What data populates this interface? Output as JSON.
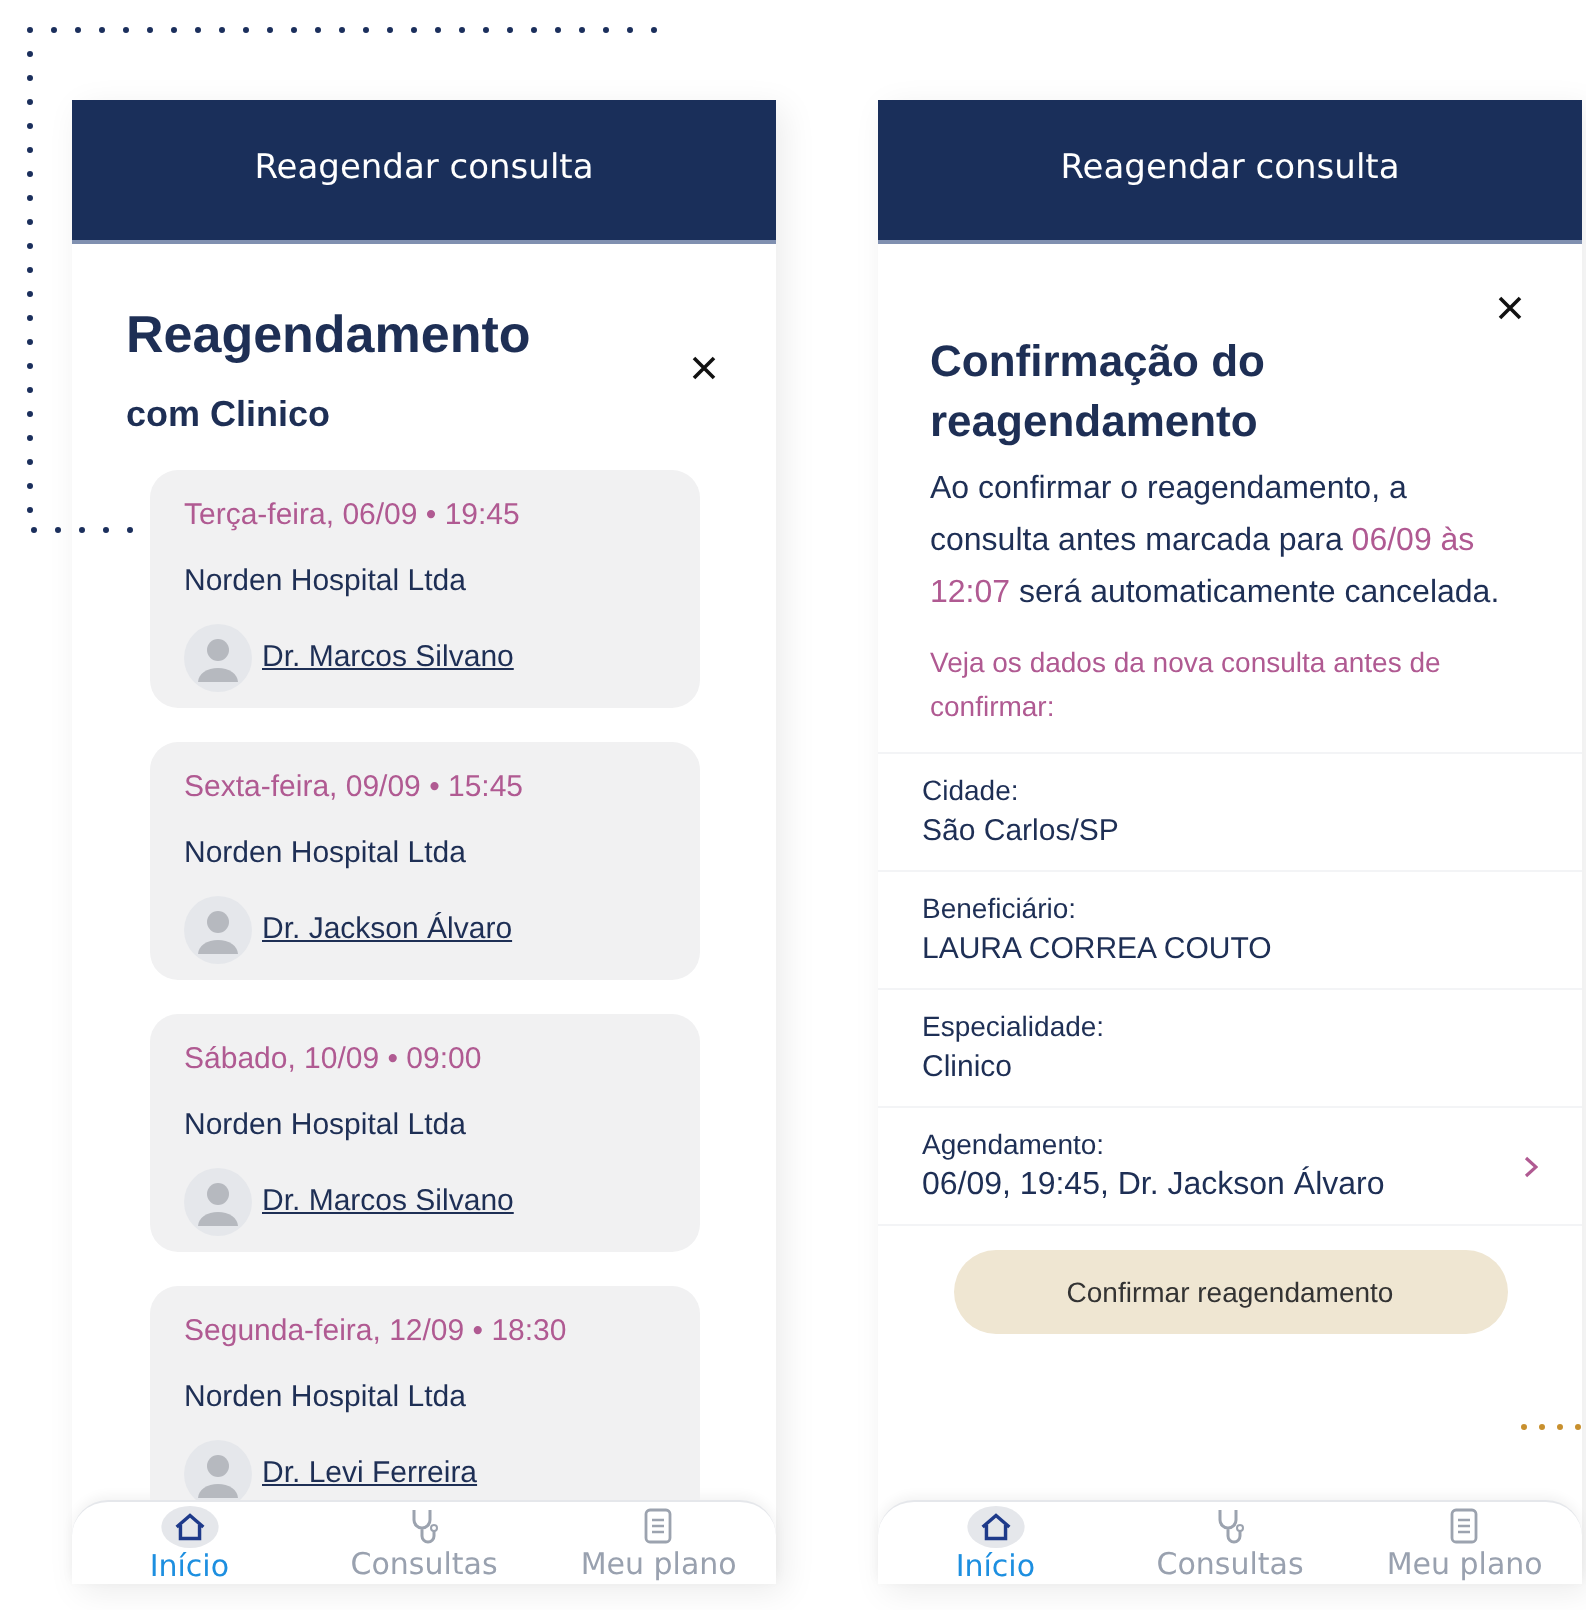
{
  "left_screen": {
    "header": "Reagendar consulta",
    "title": "Reagendamento",
    "subtitle": "com Clinico",
    "slots": [
      {
        "when": "Terça-feira, 06/09 • 19:45",
        "place": "Norden Hospital Ltda",
        "doctor": "Dr. Marcos Silvano"
      },
      {
        "when": "Sexta-feira, 09/09 • 15:45",
        "place": "Norden Hospital Ltda",
        "doctor": "Dr. Jackson Álvaro"
      },
      {
        "when": "Sábado, 10/09 • 09:00",
        "place": "Norden Hospital Ltda",
        "doctor": "Dr. Marcos Silvano"
      },
      {
        "when": "Segunda-feira, 12/09 • 18:30",
        "place": "Norden Hospital Ltda",
        "doctor": "Dr. Levi Ferreira"
      }
    ],
    "nav": [
      {
        "label": "Início",
        "selected": true
      },
      {
        "label": "Consultas",
        "selected": false
      },
      {
        "label": "Meu plano",
        "selected": false
      }
    ]
  },
  "right_screen": {
    "header": "Reagendar consulta",
    "title": "Confirmação do reagendamento",
    "message": [
      {
        "text": "Ao confirmar o reagendamento, a consulta antes marcada para ",
        "highlight": false
      },
      {
        "text": "06/09 às 12:07",
        "highlight": true
      },
      {
        "text": " será automaticamente cancelada.",
        "highlight": false
      }
    ],
    "hint": "Veja os dados da nova consulta antes de confirmar:",
    "details": [
      {
        "label": "Cidade:",
        "value": "São Carlos/SP",
        "has_arrow": false
      },
      {
        "label": "Beneficiário:",
        "value": "LAURA CORREA COUTO",
        "has_arrow": false
      },
      {
        "label": "Especialidade:",
        "value": "Clinico",
        "has_arrow": false
      },
      {
        "label": "Agendamento:",
        "value": "06/09, 19:45, Dr. Jackson Álvaro",
        "has_arrow": true
      }
    ],
    "confirm_button": "Confirmar reagendamento",
    "nav": [
      {
        "label": "Início",
        "selected": true
      },
      {
        "label": "Consultas",
        "selected": false
      },
      {
        "label": "Meu plano",
        "selected": false
      }
    ]
  }
}
